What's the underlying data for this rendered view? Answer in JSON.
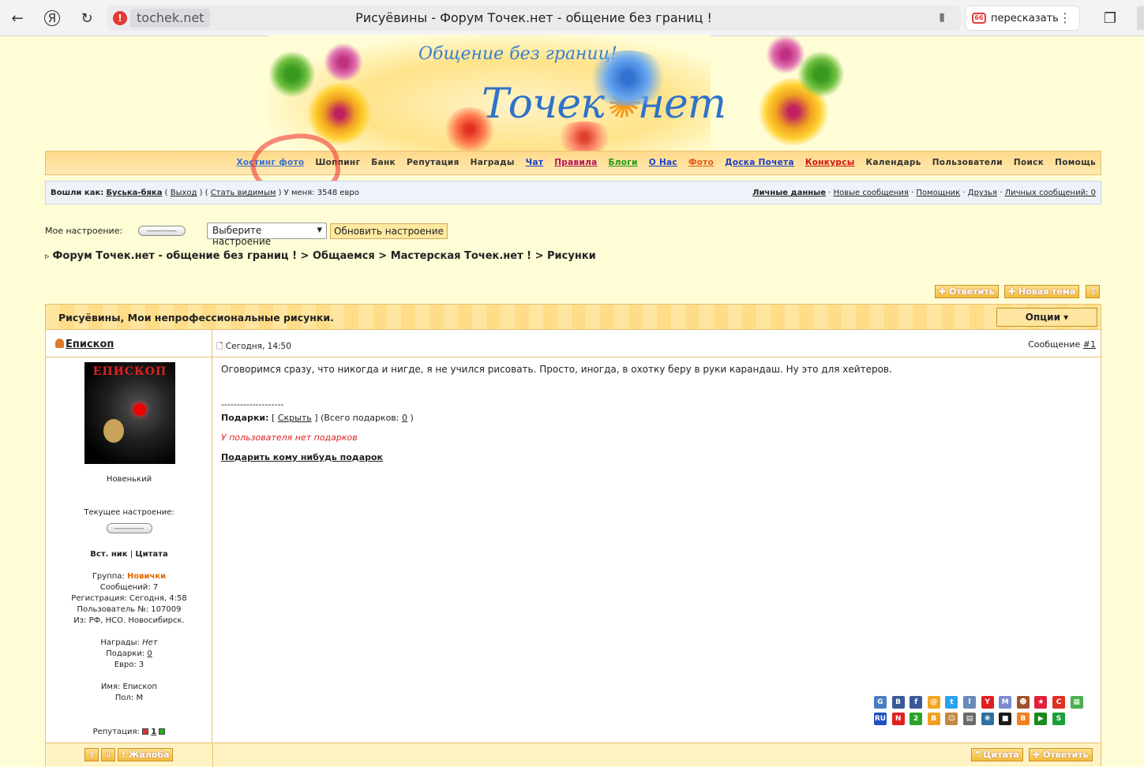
{
  "browser": {
    "host": "tochek.net",
    "title": "Рисуёвины - Форум Точек.нет - общение без границ !",
    "retell_label": "пересказать"
  },
  "banner": {
    "tagline": "Общение без границ!",
    "logo": "Точек нет"
  },
  "nav": [
    {
      "label": "Хостинг фото",
      "color": "#3a6fd0",
      "u": true
    },
    {
      "label": "Шоппинг",
      "color": "#333",
      "u": false
    },
    {
      "label": "Банк",
      "color": "#333",
      "u": false
    },
    {
      "label": "Репутация",
      "color": "#333",
      "u": false
    },
    {
      "label": "Награды",
      "color": "#333",
      "u": false
    },
    {
      "label": "Чат",
      "color": "#1a3ec8",
      "u": true
    },
    {
      "label": "Правила",
      "color": "#b0105a",
      "u": true
    },
    {
      "label": "Блоги",
      "color": "#1a9a1a",
      "u": true
    },
    {
      "label": "О Нас",
      "color": "#1a3ec8",
      "u": true
    },
    {
      "label": "Фото",
      "color": "#e05a1a",
      "u": true
    },
    {
      "label": "Доска Почета",
      "color": "#1a3ec8",
      "u": true
    },
    {
      "label": "Конкурсы",
      "color": "#d01010",
      "u": true
    },
    {
      "label": "Календарь",
      "color": "#333",
      "u": false
    },
    {
      "label": "Пользователи",
      "color": "#333",
      "u": false
    },
    {
      "label": "Поиск",
      "color": "#333",
      "u": false
    },
    {
      "label": "Помощь",
      "color": "#333",
      "u": false
    }
  ],
  "userbar": {
    "logged_as": "Вошли как:",
    "user": "Буська-бяка",
    "exit": "Выход",
    "visible": "Стать видимым",
    "money": "У меня: 3548 евро",
    "personal": "Личные данные",
    "new_msgs": "Новые сообщения",
    "helper": "Помощник",
    "friends": "Друзья",
    "pm": "Личных сообщений: 0"
  },
  "mood": {
    "label": "Мое настроение:",
    "pill": "-------------",
    "select": "Выберите настроение",
    "update": "Обновить настроение"
  },
  "breadcrumb": {
    "items": [
      "Форум Точек.нет - общение без границ !",
      "Общаемся",
      "Мастерская Точек.нет !",
      "Рисунки"
    ]
  },
  "actions": {
    "reply": "Ответить",
    "new_topic": "Новая тема"
  },
  "topic": {
    "title": "Рисуёвины, Мои непрофессиональные рисунки.",
    "options": "Опции"
  },
  "post": {
    "author": "Епископ",
    "avatar_text": "ЕПИСКОП",
    "date": "Сегодня, 14:50",
    "msg_label": "Сообщение",
    "msg_num": "#1",
    "body": "Оговоримся сразу, что никогда и нигде, я не учился рисовать. Просто, иногда, в охотку беру в руки карандаш. Ну это для хейтеров.",
    "separator": "--------------------",
    "gifts_label": "Подарки:",
    "hide": "Скрыть",
    "total_gifts": "(Всего подарков:",
    "total_gifts_num": "0",
    "no_gifts": "У пользователя нет подарков",
    "give_gift": "Подарить кому нибудь подарок"
  },
  "profile": {
    "rank": "Новенький",
    "mood_label": "Текущее настроение:",
    "mood_pill": "-------------",
    "ins_nick": "Вст. ник",
    "quote": "Цитата",
    "group_label": "Группа:",
    "group": "Новички",
    "posts": "Сообщений: 7",
    "reg": "Регистрация: Сегодня, 4:58",
    "user_no": "Пользователь №: 107009",
    "from": "Из: РФ, НСО. Новосибирск.",
    "awards_label": "Награды:",
    "awards": "Нет",
    "gifts_label": "Подарки:",
    "gifts": "0",
    "euro": "Евро: 3",
    "name": "Имя: Епископ",
    "sex": "Пол: М",
    "rep_label": "Репутация:",
    "rep": "1"
  },
  "footer": {
    "complaint": "Жалоба",
    "quote": "Цитата",
    "reply": "Ответить"
  },
  "social_icons": [
    [
      "#4a7fc0",
      "G"
    ],
    [
      "#3b5998",
      "B"
    ],
    [
      "#3b5998",
      "f"
    ],
    [
      "#f5a623",
      "@"
    ],
    [
      "#2aa3ef",
      "t"
    ],
    [
      "#6a8ab8",
      "l"
    ],
    [
      "#e02020",
      "Y"
    ],
    [
      "#7a8cd0",
      "M"
    ],
    [
      "#a0522d",
      "☻"
    ],
    [
      "#e0203a",
      "★"
    ],
    [
      "#e03020",
      "C"
    ],
    [
      "#4caf50",
      "▦"
    ],
    [
      "#2050c0",
      "RU"
    ],
    [
      "#e02020",
      "N"
    ],
    [
      "#2aa12a",
      "2"
    ],
    [
      "#f0a020",
      "B"
    ],
    [
      "#c08a40",
      "☺"
    ],
    [
      "#6a6a6a",
      "▤"
    ],
    [
      "#3070a0",
      "❋"
    ],
    [
      "#1a1a1a",
      "■"
    ],
    [
      "#f08020",
      "B"
    ],
    [
      "#1a8a1a",
      "▶"
    ],
    [
      "#1aa03a",
      "S"
    ]
  ]
}
